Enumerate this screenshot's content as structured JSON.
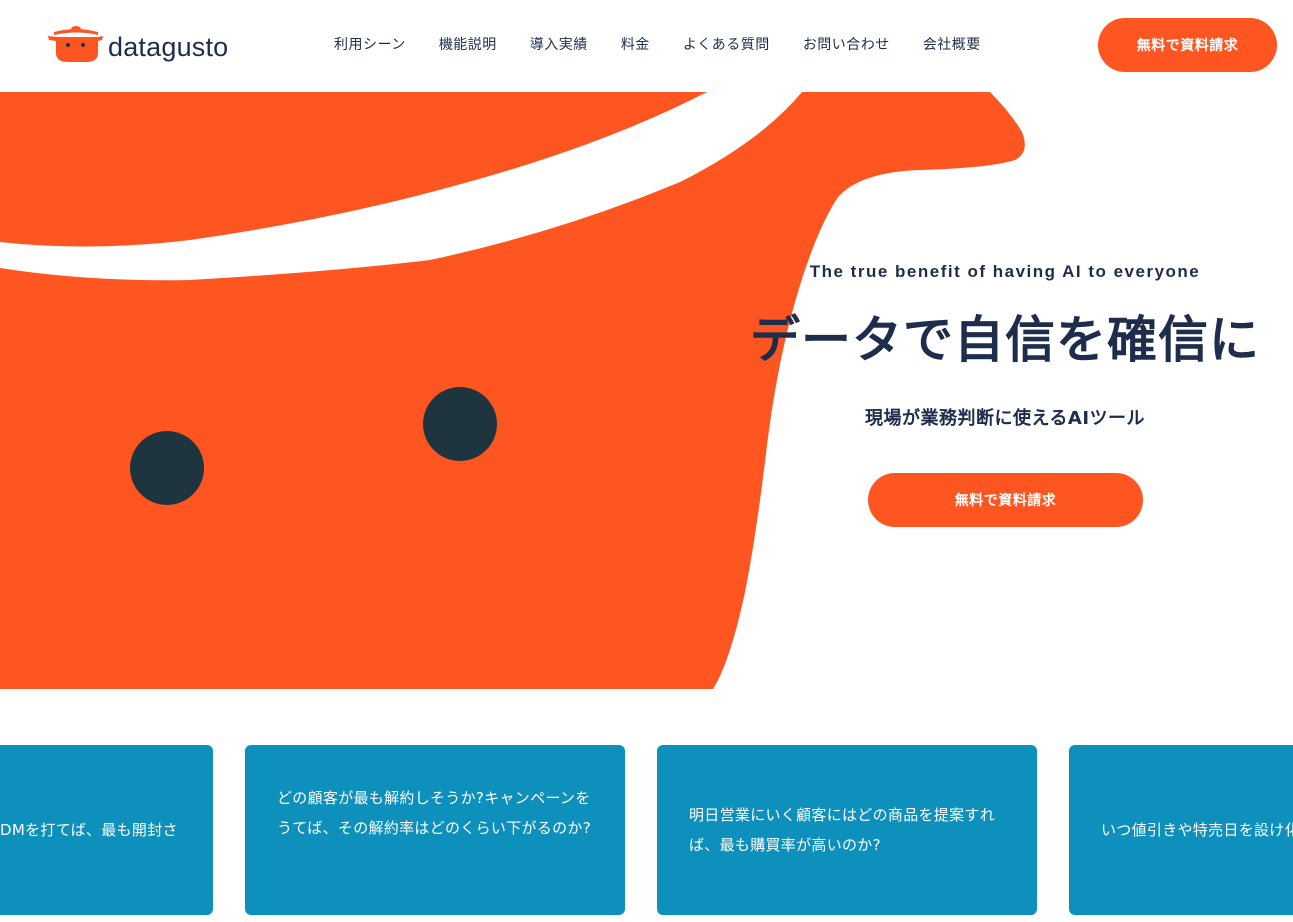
{
  "brand": {
    "name": "datagusto",
    "accent": "#ff5520",
    "navy": "#1f2d4d",
    "card_blue": "#0e90bd",
    "eye_color": "#1e3540"
  },
  "nav": {
    "items": [
      {
        "label": "利用シーン"
      },
      {
        "label": "機能説明"
      },
      {
        "label": "導入実績"
      },
      {
        "label": "料金"
      },
      {
        "label": "よくある質問"
      },
      {
        "label": "お問い合わせ"
      },
      {
        "label": "会社概要"
      }
    ],
    "cta_label": "無料で資料請求"
  },
  "hero": {
    "subtitle_en": "The true benefit of having AI to everyone",
    "title": "データで自信を確信に",
    "tagline": "現場が業務判断に使えるAIツール",
    "cta_label": "無料で資料請求"
  },
  "cards": [
    {
      "text": "DMを打てば、最も開封さ"
    },
    {
      "text": "どの顧客が最も解約しそうか?キャンペーンをうてば、その解約率はどのくらい下がるのか?"
    },
    {
      "text": "明日営業にいく顧客にはどの商品を提案すれば、最も購買率が高いのか?"
    },
    {
      "text": "いつ値引きや特売日を設け化されるのか?"
    }
  ]
}
